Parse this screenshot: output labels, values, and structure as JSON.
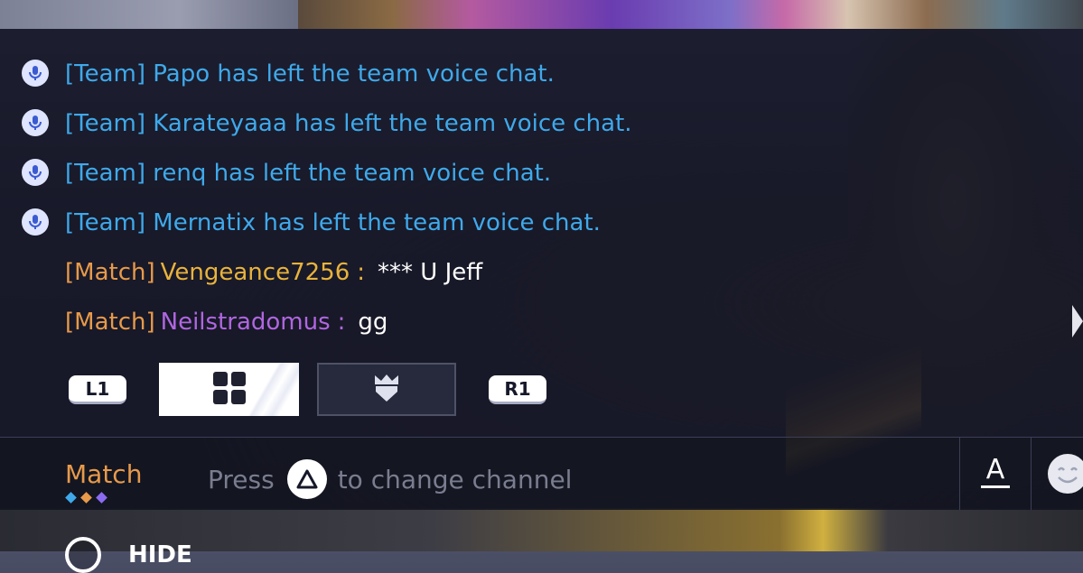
{
  "messages": [
    {
      "type": "team",
      "text": "[Team] Papo has left the team voice chat.",
      "icon": "mic-icon"
    },
    {
      "type": "team",
      "text": "[Team] Karateyaaa has left the team voice chat.",
      "icon": "mic-icon"
    },
    {
      "type": "team",
      "text": "[Team] renq has left the team voice chat.",
      "icon": "mic-icon"
    },
    {
      "type": "team",
      "text": "[Team] Mernatix has left the team voice chat.",
      "icon": "mic-icon"
    },
    {
      "type": "match",
      "channel": "[Match]",
      "sender": "Vengeance7256",
      "separator": ":",
      "text": "*** U Jeff"
    },
    {
      "type": "match",
      "channel": "[Match]",
      "sender": "Neilstradomus",
      "separator": ":",
      "text": "gg"
    }
  ],
  "tabs": {
    "prev_button": "L1",
    "next_button": "R1",
    "items": [
      {
        "icon": "grid-icon",
        "active": true
      },
      {
        "icon": "team-shield-icon",
        "active": false
      }
    ]
  },
  "channel_bar": {
    "current_channel": "Match",
    "hint_prefix": "Press",
    "hint_suffix": "to change channel",
    "hint_button_icon": "triangle-button-icon",
    "channel_dots": [
      "#3fa9ea",
      "#e79a4a",
      "#8b6cf0"
    ],
    "text_style_label": "A",
    "emoji_icon": "emoji-icon"
  },
  "footer": {
    "hide_label": "HIDE",
    "hide_button_icon": "circle-button-icon"
  },
  "colors": {
    "team_text": "#3fa9ea",
    "match_tag": "#e79a4a",
    "sender_gold": "#e8b33c",
    "sender_purple": "#b066e0"
  }
}
